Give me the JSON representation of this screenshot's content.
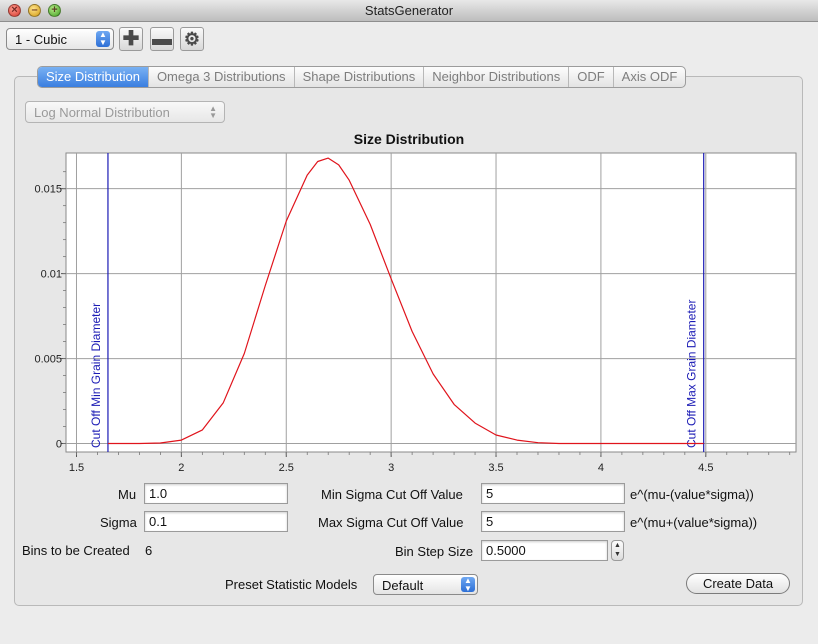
{
  "window": {
    "title": "StatsGenerator"
  },
  "toolbar": {
    "phase_select_value": "1 - Cubic",
    "add_icon": "plus-icon",
    "remove_icon": "minus-icon",
    "settings_icon": "gear-icon"
  },
  "tabs": [
    {
      "label": "Size Distribution",
      "active": true
    },
    {
      "label": "Omega 3 Distributions",
      "active": false
    },
    {
      "label": "Shape Distributions",
      "active": false
    },
    {
      "label": "Neighbor Distributions",
      "active": false
    },
    {
      "label": "ODF",
      "active": false
    },
    {
      "label": "Axis ODF",
      "active": false
    }
  ],
  "distribution_select": {
    "value": "Log Normal Distribution"
  },
  "chart_data": {
    "type": "line",
    "title": "Size Distribution",
    "xlim": [
      1.45,
      4.93
    ],
    "ylim": [
      -0.0005,
      0.0171
    ],
    "x_ticks": [
      "1.5",
      "2",
      "2.5",
      "3",
      "3.5",
      "4",
      "4.5"
    ],
    "y_ticks": [
      "0",
      "0.005",
      "0.01",
      "0.015"
    ],
    "grid": true,
    "series": [
      {
        "color": "#e0141c",
        "x": [
          1.65,
          1.8,
          1.9,
          2.0,
          2.1,
          2.2,
          2.3,
          2.4,
          2.5,
          2.6,
          2.65,
          2.7,
          2.75,
          2.8,
          2.9,
          3.0,
          3.1,
          3.2,
          3.3,
          3.4,
          3.5,
          3.6,
          3.7,
          3.8,
          4.0,
          4.2,
          4.49
        ],
        "y": [
          0.0,
          0.0,
          3e-05,
          0.0002,
          0.0008,
          0.0024,
          0.0053,
          0.0093,
          0.0131,
          0.0158,
          0.0166,
          0.0168,
          0.0164,
          0.0155,
          0.0129,
          0.0097,
          0.0066,
          0.0041,
          0.0023,
          0.0012,
          0.0005,
          0.0002,
          5e-05,
          0.0,
          0.0,
          0.0,
          0.0
        ]
      }
    ],
    "cutoff_lines": [
      {
        "x": 1.65,
        "label": "Cut Off Min Grain Diameter",
        "color": "#1b1bb5"
      },
      {
        "x": 4.49,
        "label": "Cut Off Max Grain Diameter",
        "color": "#1b1bb5"
      }
    ]
  },
  "form": {
    "mu_label": "Mu",
    "mu_value": "1.0",
    "sigma_label": "Sigma",
    "sigma_value": "0.1",
    "bins_label": "Bins to be Created",
    "bins_value": "6",
    "min_sigma_label": "Min Sigma Cut Off Value",
    "min_sigma_value": "5",
    "min_sigma_formula": "e^(mu-(value*sigma))",
    "max_sigma_label": "Max Sigma Cut Off Value",
    "max_sigma_value": "5",
    "max_sigma_formula": "e^(mu+(value*sigma))",
    "bin_step_label": "Bin Step Size",
    "bin_step_value": "0.5000",
    "preset_label": "Preset Statistic Models",
    "preset_value": "Default",
    "create_button": "Create Data"
  }
}
